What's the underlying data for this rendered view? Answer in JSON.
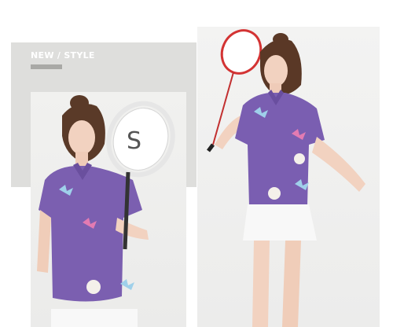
{
  "header": {
    "title": "NEW / STYLE"
  },
  "photos": [
    {
      "subject": "woman-holding-tennis-racket",
      "shirt_color": "#7b5fb0"
    },
    {
      "subject": "woman-holding-badminton-racket",
      "shirt_color": "#7a5eb1"
    }
  ],
  "colors": {
    "background": "#ffffff",
    "panel_grey": "#dededc",
    "accent_bar": "#a9a9a6",
    "shirt_purple": "#7b5fb0",
    "skirt_white": "#f8f8f8"
  }
}
